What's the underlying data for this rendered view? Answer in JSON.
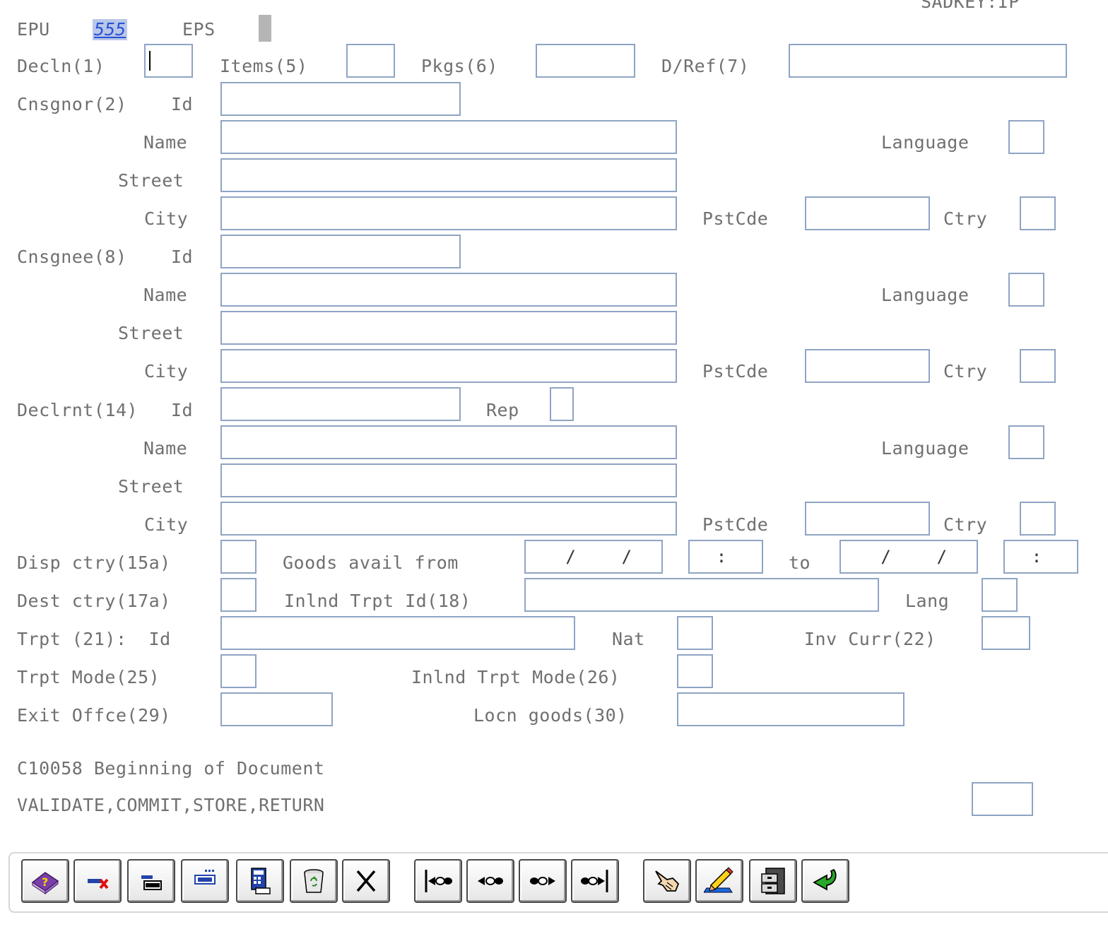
{
  "header": {
    "sadkey": "SADKEY:IP",
    "epu_label": "EPU",
    "epu_value": "555",
    "eps_label": "EPS"
  },
  "row1": {
    "decln": "Decln(1)",
    "items": "Items(5)",
    "pkgs": "Pkgs(6)",
    "dref": "D/Ref(7)"
  },
  "consignor": {
    "label": "Cnsgnor(2)",
    "id": "Id",
    "name": "Name",
    "street": "Street",
    "city": "City",
    "language": "Language",
    "pstcde": "PstCde",
    "ctry": "Ctry"
  },
  "consignee": {
    "label": "Cnsgnee(8)",
    "id": "Id",
    "name": "Name",
    "street": "Street",
    "city": "City",
    "language": "Language",
    "pstcde": "PstCde",
    "ctry": "Ctry"
  },
  "declarant": {
    "label": "Declrnt(14)",
    "id": "Id",
    "rep": "Rep",
    "name": "Name",
    "street": "Street",
    "city": "City",
    "language": "Language",
    "pstcde": "PstCde",
    "ctry": "Ctry"
  },
  "dispatch": {
    "disp_ctry": "Disp ctry(15a)",
    "goods_avail_from": "Goods avail from",
    "to": "to",
    "date_from": " /  /",
    "time_from": ":",
    "date_to": " /  /",
    "time_to": ":"
  },
  "dest": {
    "dest_ctry": "Dest ctry(17a)",
    "inlnd_trpt_id": "Inlnd Trpt Id(18)",
    "lang": "Lang"
  },
  "transport": {
    "trpt_id": "Trpt (21):  Id",
    "nat": "Nat",
    "inv_curr": "Inv Curr(22)",
    "trpt_mode": "Trpt Mode(25)",
    "inlnd_trpt_mode": "Inlnd Trpt Mode(26)",
    "exit_offce": "Exit Offce(29)",
    "locn_goods": "Locn goods(30)"
  },
  "messages": {
    "line1": "C10058 Beginning of Document",
    "line2": "VALIDATE,COMMIT,STORE,RETURN"
  },
  "toolbar_icons": [
    "help-book-icon",
    "delete-line-icon",
    "insert-line-icon",
    "duplicate-line-icon",
    "calculator-icon",
    "trash-can-icon",
    "close-x-icon",
    "first-record-icon",
    "previous-record-icon",
    "next-record-icon",
    "last-record-icon",
    "pointing-hand-icon",
    "edit-pencil-icon",
    "file-cabinet-icon",
    "return-arrow-icon"
  ]
}
